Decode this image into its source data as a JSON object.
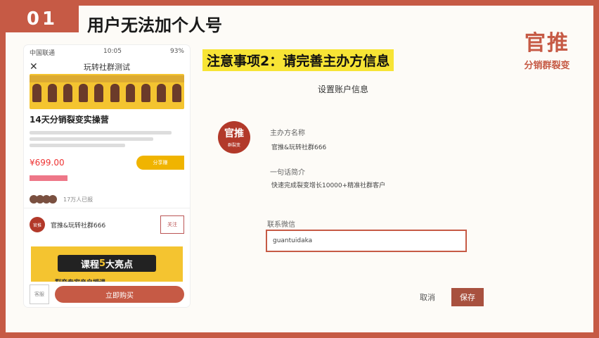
{
  "slide": {
    "number": "01",
    "title": "用户无法加个人号"
  },
  "brand": {
    "main": "官推",
    "sub": "分销群裂变"
  },
  "phone": {
    "status_left": "中国联通",
    "status_center": "10:05",
    "status_right": "93%",
    "close": "✕",
    "header_title": "玩转社群测试",
    "course_title": "14天分销裂变实操营",
    "price": "¥699.00",
    "share_label": "分享赚",
    "avatars_text": "17万人已报",
    "org_logo": "官推",
    "org_name": "官推&玩转社群666",
    "org_button": "关注",
    "highlight_pre": "课程",
    "highlight_num": "5",
    "highlight_post": "大亮点",
    "highlight_sub": "裂变专家亲自授课",
    "buy_icon": "客服",
    "buy_button": "立即购买"
  },
  "note": "注意事项2：请完善主办方信息",
  "panel": {
    "title": "设置账户信息",
    "org_logo_main": "官推",
    "org_logo_sub": "群裂变",
    "name_label": "主办方名称",
    "name_value": "官推&玩转社群666",
    "intro_label": "一句话简介",
    "intro_value": "快速完成裂变增长10000+精准社群客户",
    "wechat_label": "联系微信",
    "wechat_value": "guantuidaka",
    "cancel": "取消",
    "save": "保存"
  },
  "colors": {
    "accent": "#c65a45",
    "highlight": "#f7e435",
    "banner": "#f4c430"
  }
}
